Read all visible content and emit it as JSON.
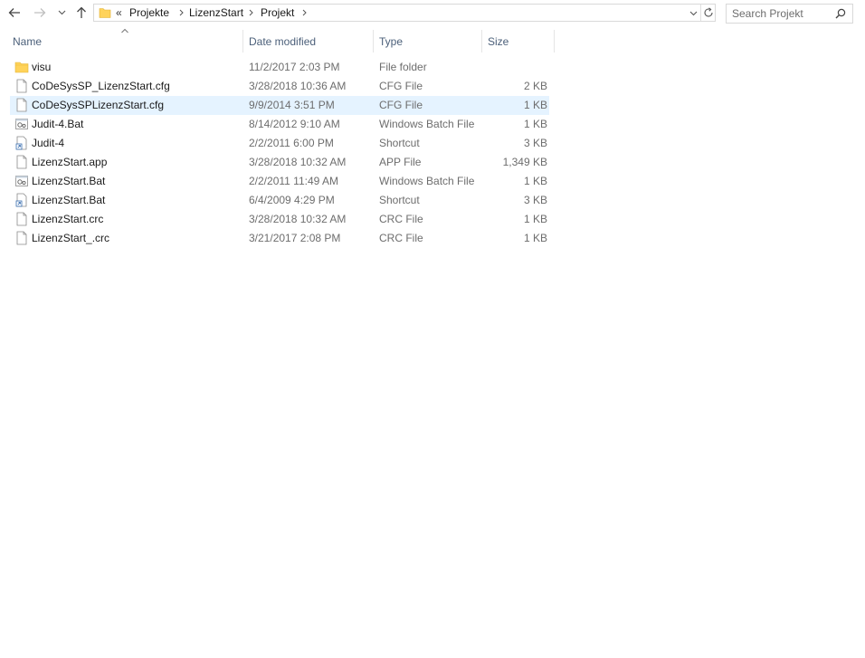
{
  "address": {
    "overflow": "«",
    "crumbs": [
      {
        "label": "Projekte"
      },
      {
        "label": "LizenzStart"
      },
      {
        "label": "Projekt"
      }
    ]
  },
  "search": {
    "placeholder": "Search Projekt",
    "value": ""
  },
  "columns": {
    "name": "Name",
    "date": "Date modified",
    "type": "Type",
    "size": "Size"
  },
  "files": [
    {
      "name": "visu",
      "date": "11/2/2017 2:03 PM",
      "type": "File folder",
      "size": "",
      "icon": "folder-icon"
    },
    {
      "name": "CoDeSysSP_LizenzStart.cfg",
      "date": "3/28/2018 10:36 AM",
      "type": "CFG File",
      "size": "2 KB",
      "icon": "file-icon"
    },
    {
      "name": "CoDeSysSPLizenzStart.cfg",
      "date": "9/9/2014 3:51 PM",
      "type": "CFG File",
      "size": "1 KB",
      "icon": "file-icon",
      "selected": true
    },
    {
      "name": "Judit-4.Bat",
      "date": "8/14/2012 9:10 AM",
      "type": "Windows Batch File",
      "size": "1 KB",
      "icon": "batch-file-icon"
    },
    {
      "name": "Judit-4",
      "date": "2/2/2011 6:00 PM",
      "type": "Shortcut",
      "size": "3 KB",
      "icon": "shortcut-icon"
    },
    {
      "name": "LizenzStart.app",
      "date": "3/28/2018 10:32 AM",
      "type": "APP File",
      "size": "1,349 KB",
      "icon": "file-icon"
    },
    {
      "name": "LizenzStart.Bat",
      "date": "2/2/2011 11:49 AM",
      "type": "Windows Batch File",
      "size": "1 KB",
      "icon": "batch-file-icon"
    },
    {
      "name": "LizenzStart.Bat",
      "date": "6/4/2009 4:29 PM",
      "type": "Shortcut",
      "size": "3 KB",
      "icon": "shortcut-icon"
    },
    {
      "name": "LizenzStart.crc",
      "date": "3/28/2018 10:32 AM",
      "type": "CRC File",
      "size": "1 KB",
      "icon": "file-icon"
    },
    {
      "name": "LizenzStart_.crc",
      "date": "3/21/2017 2:08 PM",
      "type": "CRC File",
      "size": "1 KB",
      "icon": "file-icon"
    }
  ],
  "colors": {
    "selection": "#e5f3ff",
    "header_text": "#4c607a",
    "folder": "#ffd35a"
  }
}
